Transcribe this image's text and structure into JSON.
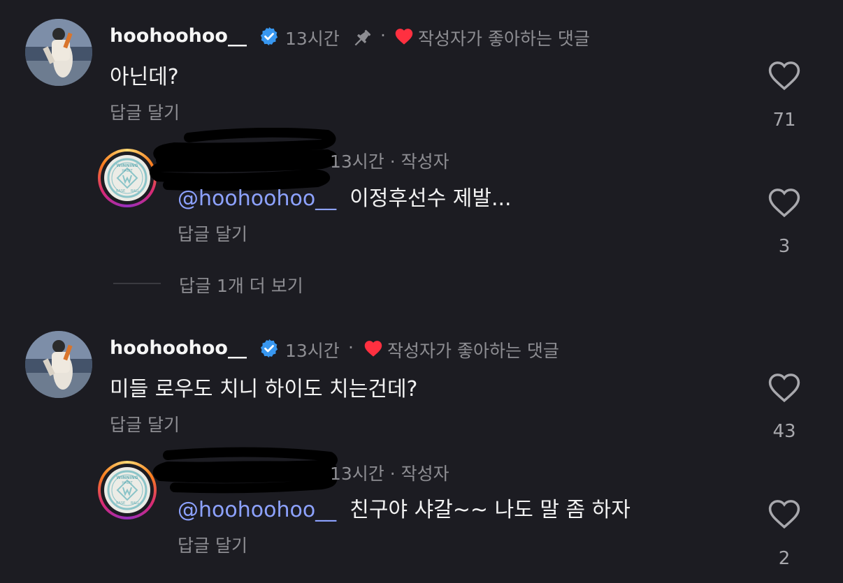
{
  "comments": [
    {
      "username": "hoohoohoo__",
      "time": "13시간",
      "sep": "·",
      "liked_label": "작성자가 좋아하는 댓글",
      "text": "아닌데?",
      "reply_label": "답글 달기",
      "likes": "71",
      "pinned": true
    },
    {
      "username": "hoohoohoo__",
      "time": "13시간",
      "sep": "·",
      "liked_label": "작성자가 좋아하는 댓글",
      "text": "미들 로우도 치니 하이도 치는건데?",
      "reply_label": "답글 달기",
      "likes": "43",
      "pinned": false
    }
  ],
  "replies": [
    {
      "time_label": "13시간 · 작성자",
      "mention": "@hoohoohoo__",
      "text": "이정후선수 제발...",
      "reply_label": "답글 달기",
      "likes": "3"
    },
    {
      "time_label": "13시간 · 작성자",
      "mention": "@hoohoohoo__",
      "text": "친구야 샤갈~~ 나도 말 좀 하자",
      "reply_label": "답글 달기",
      "likes": "2"
    }
  ],
  "more_replies": "답글 1개 더 보기",
  "brand_logo_text": [
    "WINNING",
    "HABIT",
    "BASE",
    "BALL"
  ],
  "colors": {
    "background": "#1c1c22",
    "verified": "#3897f0",
    "heart_liked": "#ff3040",
    "mention": "#8da2ff",
    "meta": "#8e8e93"
  }
}
